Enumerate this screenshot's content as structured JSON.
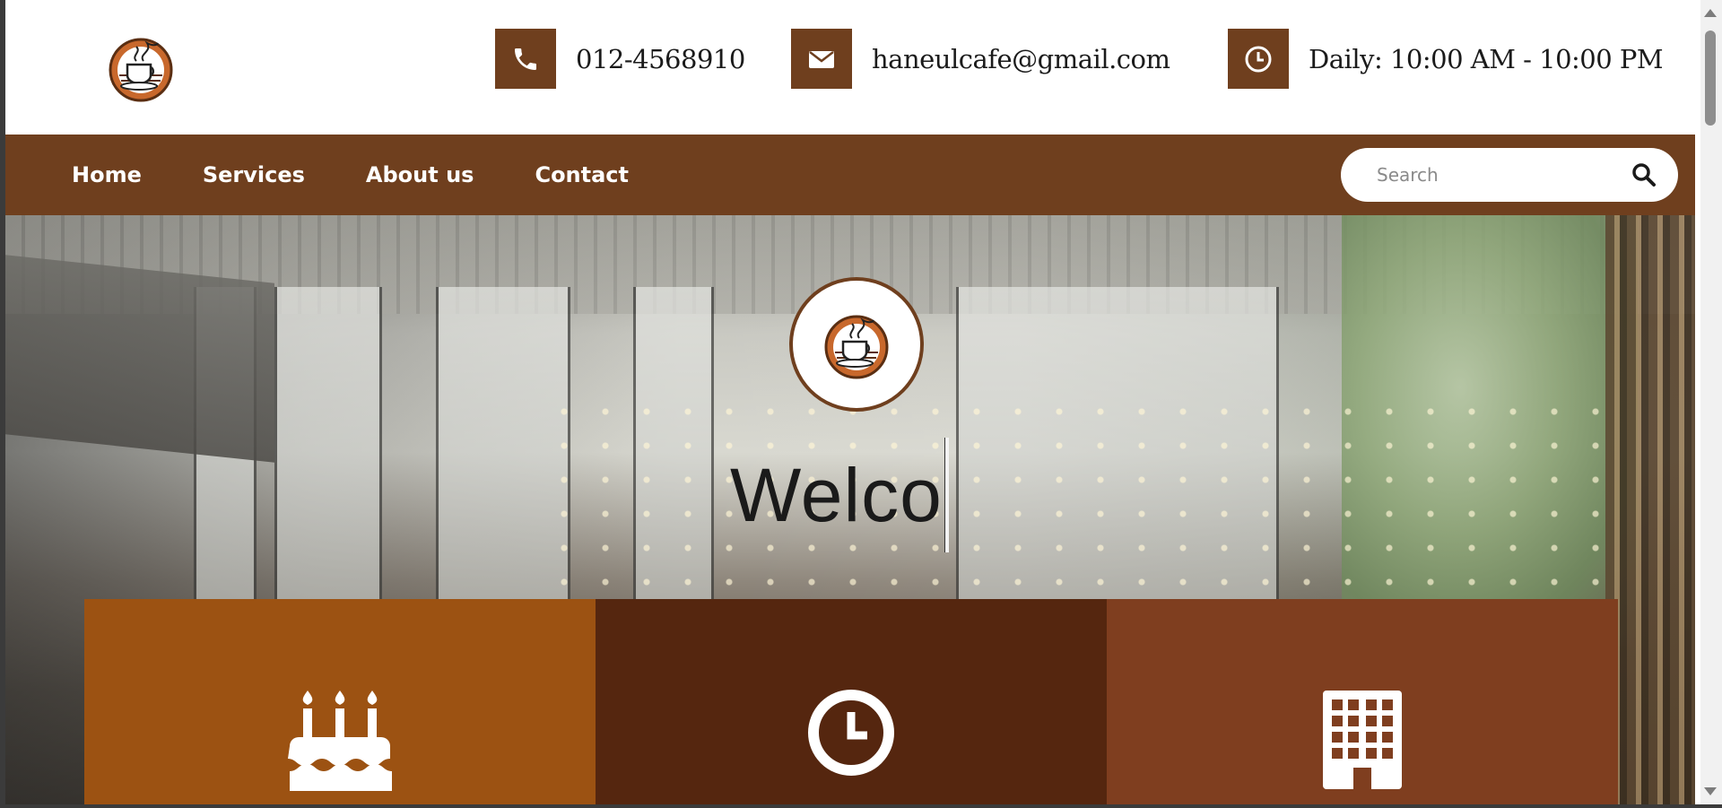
{
  "header": {
    "logo_name": "Haneul Cafe logo",
    "phone": "012-4568910",
    "email": "haneulcafe@gmail.com",
    "hours": "Daily: 10:00 AM - 10:00 PM",
    "icons": [
      "phone-icon",
      "envelope-icon",
      "clock-icon"
    ]
  },
  "nav": {
    "items": [
      {
        "label": "Home"
      },
      {
        "label": "Services"
      },
      {
        "label": "About us"
      },
      {
        "label": "Contact"
      }
    ]
  },
  "search": {
    "placeholder": "Search",
    "value": ""
  },
  "hero": {
    "title": "Welco"
  },
  "features": [
    {
      "icon": "birthday-cake-icon",
      "color": "#9c5212"
    },
    {
      "icon": "clock-icon",
      "color": "#55260f"
    },
    {
      "icon": "building-icon",
      "color": "#7f3e1f"
    }
  ],
  "colors": {
    "brand_brown": "#6f3f1e",
    "accent_orange": "#c8682c"
  }
}
